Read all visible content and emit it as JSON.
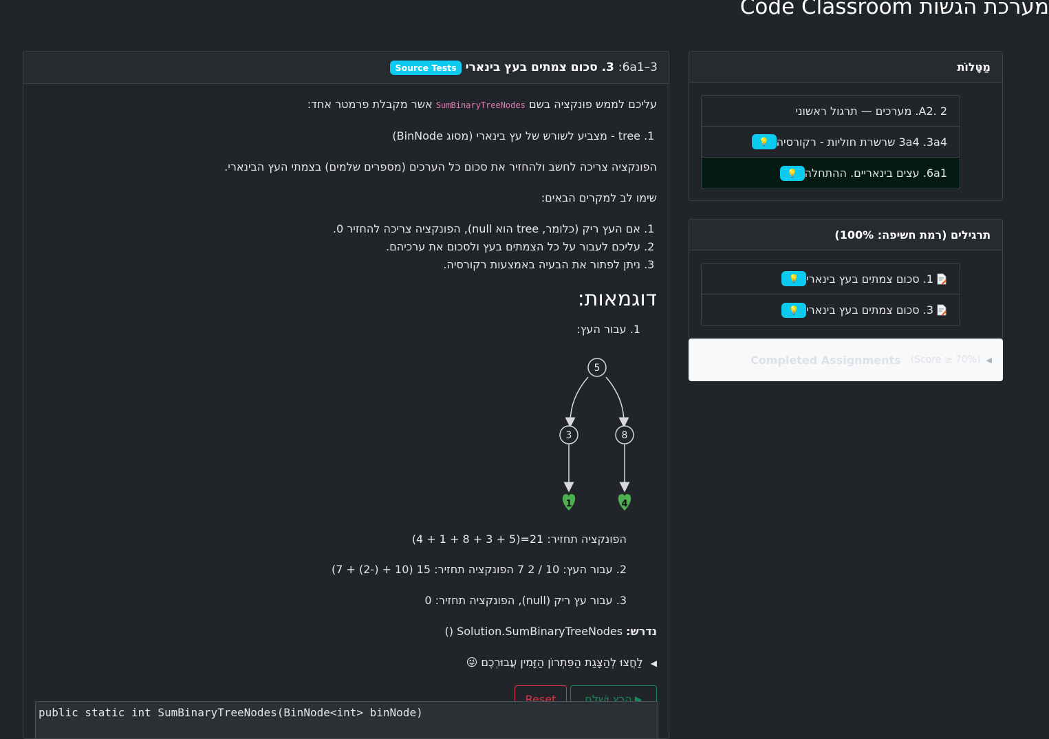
{
  "page": {
    "title": "מערכת הגשות Code Classroom"
  },
  "assignment": {
    "id": "6a1–3:",
    "title": "3. סכום צמתים בעץ בינארי",
    "badge": "Source Tests",
    "intro_before": "עליכם לממש פונקציה בשם",
    "function_name": "SumBinaryTreeNodes",
    "intro_after": "אשר מקבלת פרמטר אחד:",
    "params": [
      "tree - מצביע לשורש של עץ בינארי (מסוג BinNode)"
    ],
    "purpose": "הפונקציה צריכה לחשב ולהחזיר את סכום כל הערכים (מספרים שלמים) בצמתי העץ הבינארי.",
    "notes_title": "שימו לב למקרים הבאים:",
    "notes": [
      "אם העץ ריק (כלומר, tree הוא null), הפונקציה צריכה להחזיר 0.",
      "עליכם לעבור על כל הצמתים בעץ ולסכום את ערכיהם.",
      "ניתן לפתור את הבעיה באמצעות רקורסיה."
    ],
    "examples_title": "דוגמאות:",
    "example1_label": "1. עבור העץ:",
    "tree": {
      "root": "5",
      "left": "3",
      "right": "8",
      "left_leaf": "1",
      "right_leaf": "4"
    },
    "example1_result": "הפונקציה תחזיר: 21=(5 + 3 + 8 + 1 + 4)",
    "example2": "2. עבור העץ: 10 / 2 7 הפונקציה תחזיר: 15 (10 + (-2) + 7)",
    "example3": "3. עבור עץ ריק (null), הפונקציה תחזיר: 0",
    "required_label": "נדרש:",
    "required_value": "Solution.SumBinaryTreeNodes ()",
    "solution_toggle": "לַחֲצוּ לְהַצָּגַת הַפִּתְרוֹן הַזָּמִין עֲבוּרְכֶם",
    "solution_emoji": "😜",
    "run_label": "הָרֵץ וּשְׁלַח",
    "reset_label": "Reset",
    "code_line": "public static int SumBinaryTreeNodes(BinNode<int> binNode)"
  },
  "sidebar": {
    "topics_title": "מַטָּלוֹת",
    "topics": [
      {
        "label": "2 .A2. מערכים — תרגול ראשוני",
        "bulb": false,
        "active": false
      },
      {
        "label": "3a4 .3a4 שרשרת חוליות - רקורסיה",
        "bulb": true,
        "active": false
      },
      {
        "label": "6a1. עצים בינאריים. ההתחלה",
        "bulb": true,
        "active": true
      }
    ],
    "exercises_title": "תרגילים (רמת חשיפה: 100%)",
    "exercises": [
      {
        "label": "1. סכום צמתים בעץ בינארי",
        "bulb": true
      },
      {
        "label": "3. סכום צמתים בעץ בינארי",
        "bulb": true
      }
    ],
    "completed_label": "Completed Assignments",
    "completed_score": "(Score ≥ 70%)"
  },
  "icons": {
    "bulb": "lightbulb-icon",
    "file": "file-edit-icon",
    "play": "play-icon"
  },
  "colors": {
    "info": "#0dcaf0",
    "success": "#198754",
    "danger": "#dc3545",
    "active_bg": "#051b11"
  }
}
